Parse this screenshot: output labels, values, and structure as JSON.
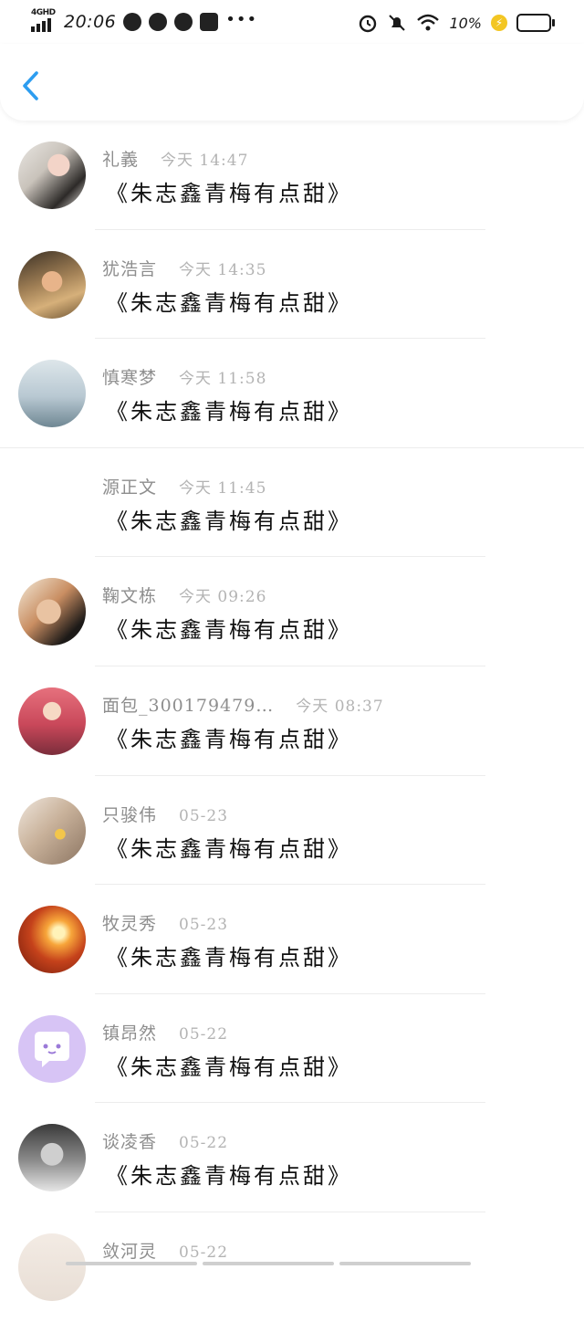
{
  "status_bar": {
    "network": "4GHD",
    "time": "20:06",
    "battery": "10%"
  },
  "messages": [
    {
      "name": "礼義",
      "time": "今天 14:47",
      "text": "《朱志鑫青梅有点甜》",
      "avatar": "avatar-girl-photo"
    },
    {
      "name": "犹浩言",
      "time": "今天 14:35",
      "text": "《朱志鑫青梅有点甜》",
      "avatar": "avatar-glasses-photo"
    },
    {
      "name": "慎寒梦",
      "time": "今天 11:58",
      "text": "《朱志鑫青梅有点甜》",
      "avatar": "avatar-text-quote"
    },
    {
      "name": "源正文",
      "time": "今天 11:45",
      "text": "《朱志鑫青梅有点甜》",
      "avatar": ""
    },
    {
      "name": "鞠文栋",
      "time": "今天 09:26",
      "text": "《朱志鑫青梅有点甜》",
      "avatar": "avatar-woman-portrait"
    },
    {
      "name": "面包_300179479…",
      "time": "今天 08:37",
      "text": "《朱志鑫青梅有点甜》",
      "avatar": "avatar-anime-girl"
    },
    {
      "name": "只骏伟",
      "time": "05-23",
      "text": "《朱志鑫青梅有点甜》",
      "avatar": "avatar-illustration-flower"
    },
    {
      "name": "牧灵秀",
      "time": "05-23",
      "text": "《朱志鑫青梅有点甜》",
      "avatar": "avatar-sunset"
    },
    {
      "name": "镇昂然",
      "time": "05-22",
      "text": "《朱志鑫青梅有点甜》",
      "avatar": "avatar-chat-bubble"
    },
    {
      "name": "谈凌香",
      "time": "05-22",
      "text": "《朱志鑫青梅有点甜》",
      "avatar": "avatar-boy-bw"
    },
    {
      "name": "敛河灵",
      "time": "05-22",
      "text": "",
      "avatar": "avatar-bunny"
    }
  ],
  "colors": {
    "accent": "#2d9df0",
    "name": "#8e8e8e",
    "time": "#b3b3b3",
    "text": "#111111"
  }
}
